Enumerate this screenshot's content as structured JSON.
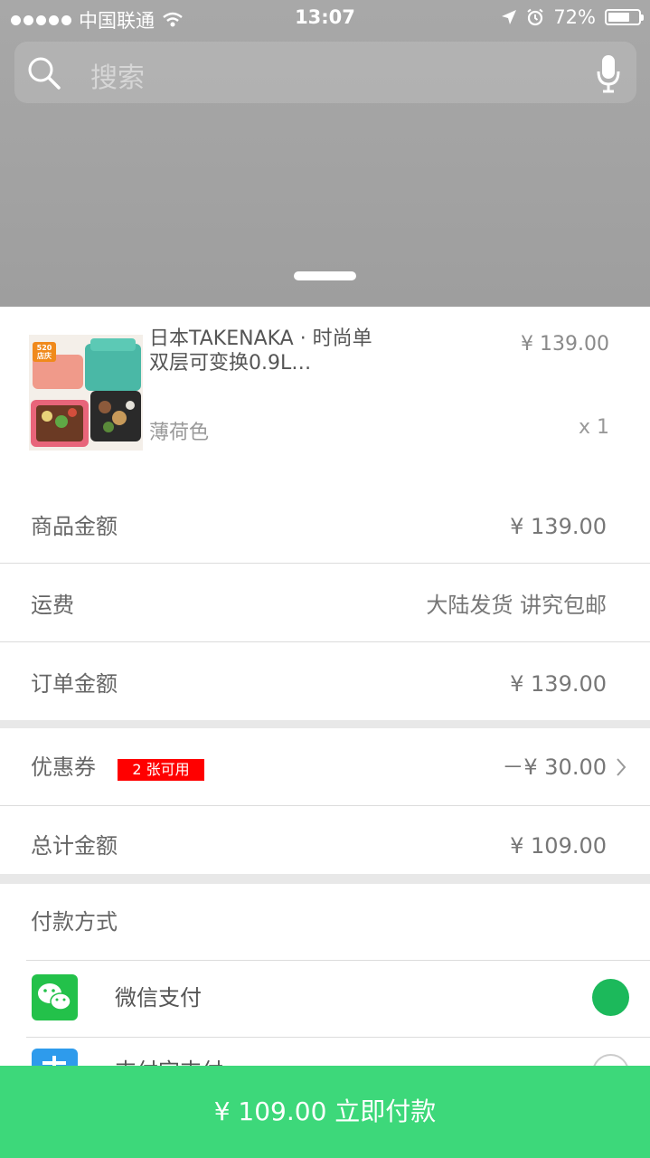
{
  "status_bar": {
    "carrier": "中国联通",
    "time": "13:07",
    "battery": "72%",
    "battery_level": 0.72
  },
  "search": {
    "placeholder": "搜索",
    "search_icon": "search-icon",
    "mic_icon": "microphone-icon"
  },
  "product": {
    "image_badge": "520 店庆",
    "name": "日本TAKENAKA · 时尚单双层可变换0.9L…",
    "price": "¥ 139.00",
    "variant": "薄荷色",
    "quantity": "x 1"
  },
  "summary": {
    "goods_amount_label": "商品金额",
    "goods_amount_value": "¥ 139.00",
    "shipping_label": "运费",
    "shipping_value": "大陆发货 讲究包邮",
    "order_amount_label": "订单金额",
    "order_amount_value": "¥ 139.00",
    "coupon_label": "优惠券",
    "coupon_badge": "2 张可用",
    "coupon_value": "－¥ 30.00",
    "total_label": "总计金额",
    "total_value": "¥ 109.00"
  },
  "payment": {
    "section_label": "付款方式",
    "methods": [
      {
        "label": "微信支付",
        "icon": "wechat-icon",
        "selected": true
      },
      {
        "label": "支付宝支付",
        "icon": "alipay-icon",
        "selected": false
      }
    ]
  },
  "pay_button": {
    "label": "¥ 109.00 立即付款"
  },
  "colors": {
    "accent_green": "#3dd87a",
    "radio_green": "#1cb95b",
    "badge_red": "#ff0000",
    "wechat_green": "#23c14a",
    "alipay_blue": "#2e9bec"
  }
}
